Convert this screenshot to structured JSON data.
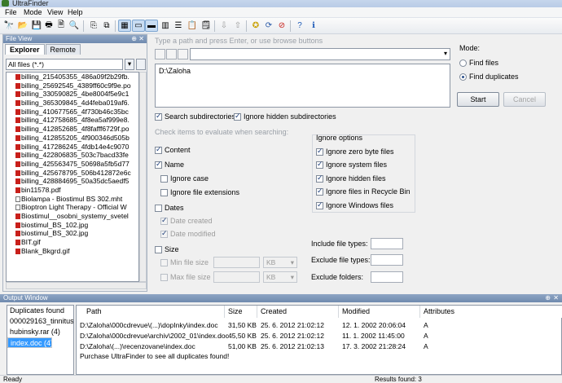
{
  "window": {
    "title": "UltraFinder"
  },
  "menu": [
    "File",
    "Mode",
    "View",
    "Help"
  ],
  "file_view": {
    "title": "File View",
    "tabs": [
      "Explorer",
      "Remote"
    ],
    "filter": "All files (*.*)",
    "files": [
      {
        "name": "billing_215405355_486a09f2b29fb.",
        "icon": "pdf"
      },
      {
        "name": "billing_25692545_4389ff60c9f9e.po",
        "icon": "pdf"
      },
      {
        "name": "billing_330590825_4be8004f5e9c1",
        "icon": "pdf"
      },
      {
        "name": "billing_365309845_4d4feba019af6.",
        "icon": "pdf"
      },
      {
        "name": "billing_410677565_4f730b46c35bc",
        "icon": "pdf"
      },
      {
        "name": "billing_412758685_4f8ea5af999e8.",
        "icon": "pdf"
      },
      {
        "name": "billing_412852685_4f8fafff6729f.po",
        "icon": "pdf"
      },
      {
        "name": "billing_412855205_4f900346d505b",
        "icon": "pdf"
      },
      {
        "name": "billing_417286245_4fdb14e4c9070",
        "icon": "pdf"
      },
      {
        "name": "billing_422806835_503c7bacd33fe",
        "icon": "pdf"
      },
      {
        "name": "billing_425563475_50698a5fb5d77",
        "icon": "pdf"
      },
      {
        "name": "billing_425678795_506b412872e6c",
        "icon": "pdf"
      },
      {
        "name": "billing_428884695_50a35dc5aedf5",
        "icon": "pdf"
      },
      {
        "name": "bin11578.pdf",
        "icon": "pdf"
      },
      {
        "name": "Biolampa - Biostimul BS 302.mht",
        "icon": "doc"
      },
      {
        "name": "Bioptron Light Therapy - Official W",
        "icon": "doc"
      },
      {
        "name": "Biostimul__osobni_systemy_svetel",
        "icon": "pdf"
      },
      {
        "name": "biostimul_BS_102.jpg",
        "icon": "img"
      },
      {
        "name": "biostimul_BS_302.jpg",
        "icon": "img"
      },
      {
        "name": "BIT.gif",
        "icon": "img"
      },
      {
        "name": "Blank_Bkgrd.gif",
        "icon": "img"
      }
    ]
  },
  "search": {
    "path_hint": "Type a path and press Enter, or use browse buttons",
    "paths": [
      "D:\\Zaloha"
    ],
    "mode_label": "Mode:",
    "mode_options": [
      "Find files",
      "Find duplicates"
    ],
    "start_label": "Start",
    "cancel_label": "Cancel",
    "search_subdirs": "Search subdirectories",
    "ignore_hidden_subdirs": "Ignore hidden subdirectories",
    "check_hint": "Check items to evaluate when searching:",
    "content": "Content",
    "name": "Name",
    "ignore_case": "Ignore case",
    "ignore_ext": "Ignore file extensions",
    "dates": "Dates",
    "date_created": "Date created",
    "date_modified": "Date modified",
    "size": "Size",
    "min_size": "Min file size",
    "max_size": "Max file size",
    "size_unit": "KB",
    "ignore_options_title": "Ignore options",
    "ignore_options": [
      "Ignore zero byte files",
      "Ignore system files",
      "Ignore hidden files",
      "Ignore files in Recycle Bin",
      "Ignore Windows files"
    ],
    "include_types": "Include file types:",
    "exclude_types": "Exclude file types:",
    "exclude_folders": "Exclude folders:"
  },
  "output": {
    "title": "Output Window",
    "dup_header": "Duplicates found",
    "duplicates": [
      "000029163_tinnitus...",
      "hubinsky.rar (4)",
      "index.doc (4)"
    ],
    "columns": [
      "Path",
      "Size",
      "Created",
      "Modified",
      "Attributes"
    ],
    "rows": [
      {
        "path": "D:\\Zaloha\\000cdrevue\\(...)\\dopInky\\index.doc",
        "size": "31,50 KB",
        "created": "25. 6. 2012 21:02:12",
        "modified": "12. 1. 2002 20:06:04",
        "attr": "A"
      },
      {
        "path": "D:\\Zaloha\\000cdrevue\\archiv\\2002_01\\index.doc",
        "size": "45,50 KB",
        "created": "25. 6. 2012 21:02:12",
        "modified": "11. 1. 2002 11:45:00",
        "attr": "A"
      },
      {
        "path": "D:\\Zaloha\\(...)\\recenzovane\\index.doc",
        "size": "51,00 KB",
        "created": "25. 6. 2012 21:02:13",
        "modified": "17. 3. 2002 21:28:24",
        "attr": "A"
      }
    ],
    "promo": "Purchase UltraFinder to see all duplicates found!"
  },
  "status": {
    "left": "Ready",
    "right": "Results found: 3"
  }
}
